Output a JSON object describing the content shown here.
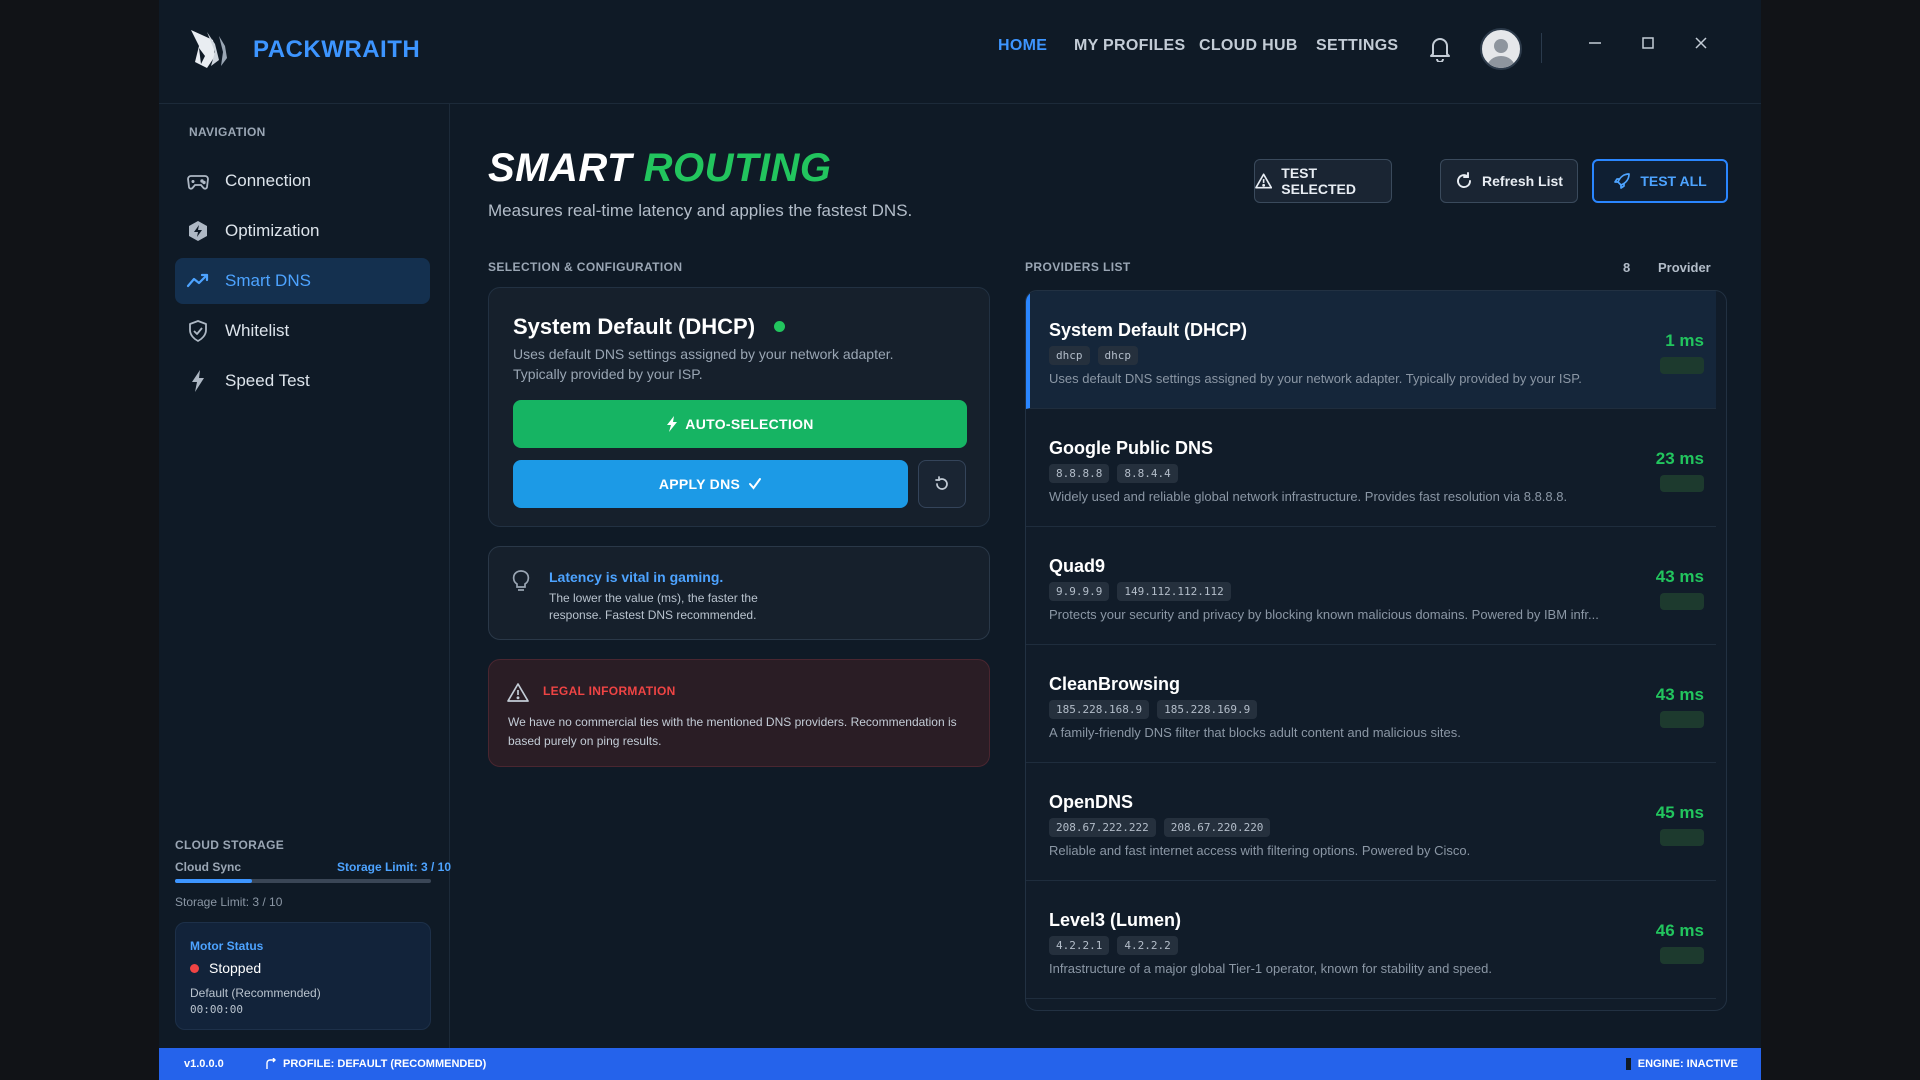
{
  "app": {
    "name": "PACKWRAITH"
  },
  "topnav": [
    {
      "label": "HOME",
      "active": true
    },
    {
      "label": "MY PROFILES",
      "active": false
    },
    {
      "label": "CLOUD HUB",
      "active": false
    },
    {
      "label": "SETTINGS",
      "active": false
    }
  ],
  "sidebar": {
    "heading": "NAVIGATION",
    "items": [
      {
        "label": "Connection",
        "icon": "gamepad-icon"
      },
      {
        "label": "Optimization",
        "icon": "hexagon-bolt-icon"
      },
      {
        "label": "Smart DNS",
        "icon": "trend-icon",
        "active": true
      },
      {
        "label": "Whitelist",
        "icon": "shield-check-icon"
      },
      {
        "label": "Speed Test",
        "icon": "bolt-icon"
      }
    ],
    "cloud": {
      "heading": "CLOUD STORAGE",
      "sync_label": "Cloud Sync",
      "limit_label": "Storage Limit: 3 / 10",
      "sub_label": "Storage Limit: 3 / 10",
      "used": 3,
      "total": 10
    },
    "motor": {
      "title": "Motor Status",
      "state": "Stopped",
      "profile": "Default (Recommended)",
      "time": "00:00:00"
    }
  },
  "header": {
    "title_word1": "SMART",
    "title_word2": "ROUTING",
    "subtitle": "Measures real-time latency and applies the fastest DNS.",
    "test_selected": "TEST SELECTED",
    "refresh": "Refresh List",
    "test_all": "TEST ALL"
  },
  "config": {
    "section_label": "SELECTION & CONFIGURATION",
    "name": "System Default (DHCP)",
    "description": "Uses default DNS settings assigned by your network adapter. Typically provided by your ISP.",
    "auto_label": "AUTO-SELECTION",
    "apply_label": "APPLY DNS"
  },
  "tip": {
    "title": "Latency is vital in gaming.",
    "body": "The lower the value (ms), the faster the response. Fastest DNS recommended."
  },
  "legal": {
    "title": "LEGAL INFORMATION",
    "body": "We have no commercial ties with the mentioned DNS providers. Recommendation is based purely on ping results."
  },
  "providers": {
    "section_label": "PROVIDERS LIST",
    "count": "8",
    "count_label": "Provider",
    "items": [
      {
        "name": "System Default (DHCP)",
        "tags": [
          "dhcp",
          "dhcp"
        ],
        "desc": "Uses default DNS settings assigned by your network adapter. Typically provided by your ISP.",
        "ms": "1 ms",
        "selected": true
      },
      {
        "name": "Google Public DNS",
        "tags": [
          "8.8.8.8",
          "8.8.4.4"
        ],
        "desc": "Widely used and reliable global network infrastructure. Provides fast resolution via 8.8.8.8.",
        "ms": "23 ms"
      },
      {
        "name": "Quad9",
        "tags": [
          "9.9.9.9",
          "149.112.112.112"
        ],
        "desc": "Protects your security and privacy by blocking known malicious domains. Powered by IBM infr...",
        "ms": "43 ms"
      },
      {
        "name": "CleanBrowsing",
        "tags": [
          "185.228.168.9",
          "185.228.169.9"
        ],
        "desc": "A family-friendly DNS filter that blocks adult content and malicious sites.",
        "ms": "43 ms"
      },
      {
        "name": "OpenDNS",
        "tags": [
          "208.67.222.222",
          "208.67.220.220"
        ],
        "desc": "Reliable and fast internet access with filtering options. Powered by Cisco.",
        "ms": "45 ms"
      },
      {
        "name": "Level3 (Lumen)",
        "tags": [
          "4.2.2.1",
          "4.2.2.2"
        ],
        "desc": "Infrastructure of a major global Tier-1 operator, known for stability and speed.",
        "ms": "46 ms"
      }
    ]
  },
  "statusbar": {
    "version": "v1.0.0.0",
    "profile": "PROFILE: DEFAULT (RECOMMENDED)",
    "engine": "ENGINE: INACTIVE"
  },
  "colors": {
    "accent_blue": "#3d95ff",
    "accent_green": "#22c55e",
    "danger": "#ef4444",
    "statusbar": "#2563eb"
  }
}
